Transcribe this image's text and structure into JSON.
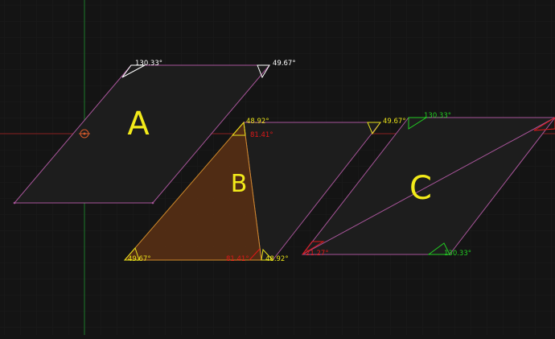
{
  "colors": {
    "background": "#141414",
    "grid_minor": "#1c1c1c",
    "grid_major": "#232323",
    "x_axis": "#8a1f1f",
    "y_axis": "#1c7a2a",
    "edge": "#a8559a",
    "fill": "#1d1d1d",
    "triangle_fill": "#5a3014",
    "triangle_edge": "#d08a2a",
    "label_yellow": "#f2ea1a",
    "angle_yellow": "#e8e01a",
    "angle_white": "#ffffff",
    "angle_red": "#e01818",
    "angle_green": "#22cc22",
    "origin": "#d65a2a"
  },
  "shapes": {
    "label_a": "A",
    "label_b": "B",
    "label_c": "C"
  },
  "angles": {
    "a_top_left": "130.33°",
    "a_top_right": "49.67°",
    "b_top": "48.92°",
    "b_top_red": "81.41°",
    "b_right_top": "49.67°",
    "b_bottom_left": "49.67°",
    "b_bottom_red": "81.41°",
    "b_bottom_right": "48.92°",
    "c_top": "130.33°",
    "c_bottom_left": "21.27°",
    "c_bottom_right": "130.33°"
  },
  "icons": {
    "origin": "crosshair-origin-icon"
  }
}
